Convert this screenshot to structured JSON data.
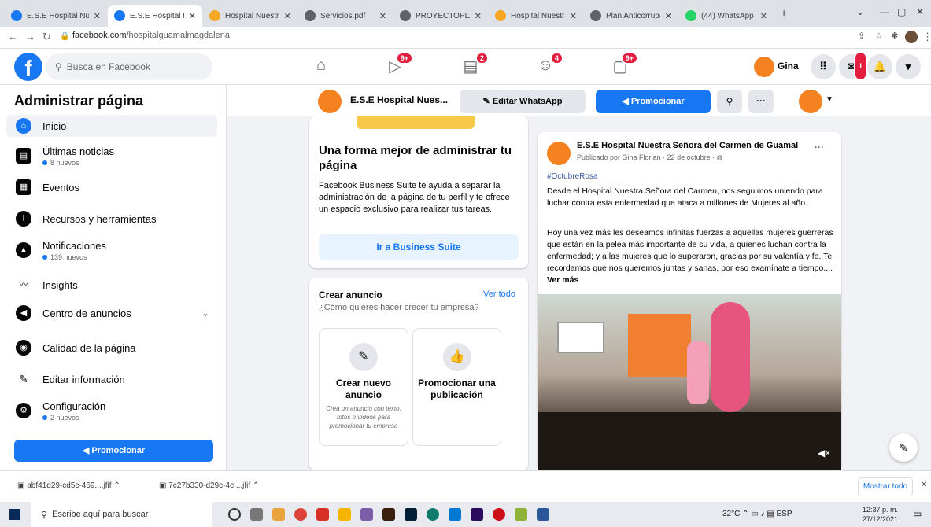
{
  "browser": {
    "tabs": [
      {
        "title": "E.S.E Hospital Nu",
        "active": false,
        "favicon_color": "#1877f2"
      },
      {
        "title": "E.S.E Hospital Nu",
        "active": true,
        "favicon_color": "#1877f2"
      },
      {
        "title": "Hospital Nuestra",
        "active": false,
        "favicon_color": "#f5a623"
      },
      {
        "title": "Servicios.pdf",
        "active": false,
        "favicon_color": "#5f6368"
      },
      {
        "title": "PROYECTOPLANC",
        "active": false,
        "favicon_color": "#5f6368"
      },
      {
        "title": "Hospital Nuestra",
        "active": false,
        "favicon_color": "#f5a623"
      },
      {
        "title": "Plan Anticorrupc",
        "active": false,
        "favicon_color": "#5f6368"
      },
      {
        "title": "(44) WhatsApp",
        "active": false,
        "favicon_color": "#25d366"
      }
    ],
    "url_domain": "facebook.com",
    "url_path": "/hospitalguamalmagdalena"
  },
  "fb_header": {
    "search_placeholder": "Busca en Facebook",
    "nav": [
      {
        "icon": "home-icon",
        "badge": ""
      },
      {
        "icon": "video-icon",
        "badge": "9+"
      },
      {
        "icon": "marketplace-icon",
        "badge": "2"
      },
      {
        "icon": "groups-icon",
        "badge": "4"
      },
      {
        "icon": "gaming-icon",
        "badge": "9+"
      }
    ],
    "user_name": "Gina",
    "messenger_badge": "1"
  },
  "sidebar": {
    "title": "Administrar página",
    "items": [
      {
        "label": "Inicio",
        "icon": "home-icon",
        "sub": ""
      },
      {
        "label": "Últimas noticias",
        "icon": "news-icon",
        "sub": "8 nuevos"
      },
      {
        "label": "Eventos",
        "icon": "calendar-icon",
        "sub": ""
      },
      {
        "label": "Recursos y herramientas",
        "icon": "info-icon",
        "sub": ""
      },
      {
        "label": "Notificaciones",
        "icon": "bell-icon",
        "sub": "139 nuevos"
      },
      {
        "label": "Insights",
        "icon": "insights-icon",
        "sub": ""
      },
      {
        "label": "Centro de anuncios",
        "icon": "megaphone-icon",
        "sub": ""
      },
      {
        "label": "Calidad de la página",
        "icon": "shield-icon",
        "sub": ""
      },
      {
        "label": "Editar información",
        "icon": "pencil-icon",
        "sub": ""
      },
      {
        "label": "Configuración",
        "icon": "gear-icon",
        "sub": "2 nuevos"
      }
    ],
    "promote_label": "Promocionar"
  },
  "page_toolbar": {
    "page_name": "E.S.E Hospital Nues...",
    "edit_whatsapp": "Editar WhatsApp",
    "promote": "Promocionar"
  },
  "business_card": {
    "title": "Una forma mejor de administrar tu página",
    "text": "Facebook Business Suite te ayuda a separar la administración de la página de tu perfil y te ofrece un espacio exclusivo para realizar tus tareas.",
    "button": "Ir a Business Suite"
  },
  "ad_card": {
    "title": "Crear anuncio",
    "see_all": "Ver todo",
    "question": "¿Cómo quieres hacer crecer tu empresa?",
    "options": [
      {
        "title": "Crear nuevo anuncio",
        "desc": "Crea un anuncio con texto, fotos o vídeos para promocionar tu empresa",
        "icon": "edit-icon"
      },
      {
        "title": "Promocionar una publicación",
        "desc": "",
        "icon": "thumbs-up-icon"
      }
    ]
  },
  "post": {
    "author": "E.S.E Hospital Nuestra Señora del Carmen de Guamal",
    "meta": "Publicado por Gina Florian · 22 de octubre ·",
    "hashtag": "#OctubreRosa",
    "p1": "Desde el Hospital Nuestra Señora del Carmen, nos seguimos uniendo para luchar contra esta enfermedad que ataca a millones de Mujeres al año.",
    "p2": "Hoy una vez más les deseamos infinitas fuerzas a aquellas mujeres guerreras que están en la pelea más importante de su vida, a quienes luchan contra la enfermedad; y a las mujeres que lo superaron, gracias por su valentía y fe. Te recordamos que nos queremos juntas y sanas, por eso examínate a tiempo....",
    "see_more": "Ver más"
  },
  "downloads": {
    "files": [
      "abf41d29-cd5c-469....jfif",
      "7c27b330-d29c-4c....jfif"
    ],
    "show_all": "Mostrar todo"
  },
  "taskbar": {
    "search_placeholder": "Escribe aquí para buscar",
    "temperature": "32°C",
    "lang": "ESP",
    "time": "12:37 p. m.",
    "date": "27/12/2021"
  }
}
